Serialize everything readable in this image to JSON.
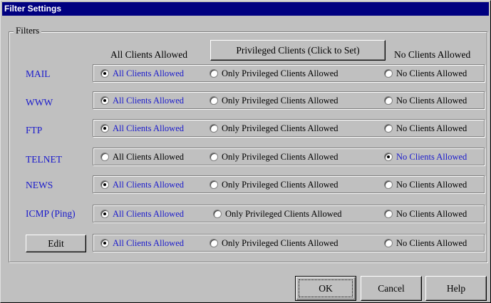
{
  "window": {
    "title": "Filter Settings"
  },
  "filters": {
    "group_label": "Filters",
    "headers": {
      "all": "All Clients Allowed",
      "privileged_button": "Privileged Clients (Click to Set)",
      "none": "No Clients Allowed"
    },
    "option_labels": {
      "all": "All Clients Allowed",
      "privileged": "Only Privileged Clients Allowed",
      "none": "No Clients Allowed"
    },
    "rows": [
      {
        "label": "MAIL",
        "selected": "all"
      },
      {
        "label": "WWW",
        "selected": "all"
      },
      {
        "label": "FTP",
        "selected": "all"
      },
      {
        "label": "TELNET",
        "selected": "none"
      },
      {
        "label": "NEWS",
        "selected": "all"
      },
      {
        "label": "ICMP (Ping)",
        "selected": "all"
      }
    ],
    "edit_row": {
      "button_label": "Edit",
      "selected": "all"
    }
  },
  "footer": {
    "ok_label": "OK",
    "cancel_label": "Cancel",
    "help_label": "Help"
  },
  "colors": {
    "title_bar": "#000080",
    "face": "#c0c0c0",
    "selected_text": "#1a1acc"
  }
}
